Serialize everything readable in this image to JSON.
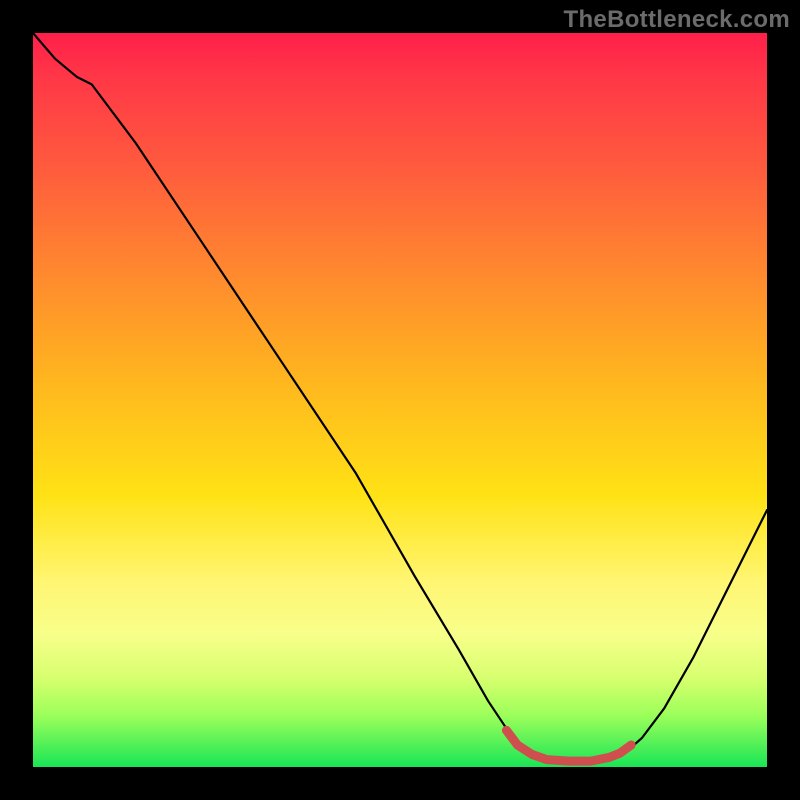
{
  "watermark": "TheBottleneck.com",
  "colors": {
    "curve": "#000000",
    "highlight": "#cf4f4f",
    "background_top": "#ff1f4a",
    "background_bottom": "#19e556",
    "frame": "#000000"
  },
  "chart_data": {
    "type": "line",
    "title": "",
    "xlabel": "",
    "ylabel": "",
    "xlim": [
      0,
      100
    ],
    "ylim": [
      0,
      100
    ],
    "curve_points": [
      {
        "x": 0.0,
        "y": 100.0
      },
      {
        "x": 3.0,
        "y": 96.5
      },
      {
        "x": 6.0,
        "y": 94.0
      },
      {
        "x": 8.0,
        "y": 93.0
      },
      {
        "x": 14.0,
        "y": 85.0
      },
      {
        "x": 24.0,
        "y": 70.0
      },
      {
        "x": 34.0,
        "y": 55.0
      },
      {
        "x": 44.0,
        "y": 40.0
      },
      {
        "x": 52.0,
        "y": 26.0
      },
      {
        "x": 58.0,
        "y": 16.0
      },
      {
        "x": 62.0,
        "y": 9.0
      },
      {
        "x": 65.0,
        "y": 4.5
      },
      {
        "x": 67.0,
        "y": 2.5
      },
      {
        "x": 69.0,
        "y": 1.3
      },
      {
        "x": 72.0,
        "y": 0.8
      },
      {
        "x": 76.0,
        "y": 0.8
      },
      {
        "x": 79.0,
        "y": 1.2
      },
      {
        "x": 81.0,
        "y": 2.2
      },
      {
        "x": 83.0,
        "y": 4.0
      },
      {
        "x": 86.0,
        "y": 8.0
      },
      {
        "x": 90.0,
        "y": 15.0
      },
      {
        "x": 95.0,
        "y": 25.0
      },
      {
        "x": 100.0,
        "y": 35.0
      }
    ],
    "highlight_range_x": [
      64.5,
      81.5
    ],
    "highlight_points": [
      {
        "x": 64.5,
        "y": 5.0
      },
      {
        "x": 66.0,
        "y": 3.0
      },
      {
        "x": 68.0,
        "y": 1.7
      },
      {
        "x": 70.0,
        "y": 1.0
      },
      {
        "x": 73.0,
        "y": 0.8
      },
      {
        "x": 76.0,
        "y": 0.8
      },
      {
        "x": 78.5,
        "y": 1.3
      },
      {
        "x": 80.0,
        "y": 1.9
      },
      {
        "x": 81.5,
        "y": 3.0
      }
    ]
  }
}
